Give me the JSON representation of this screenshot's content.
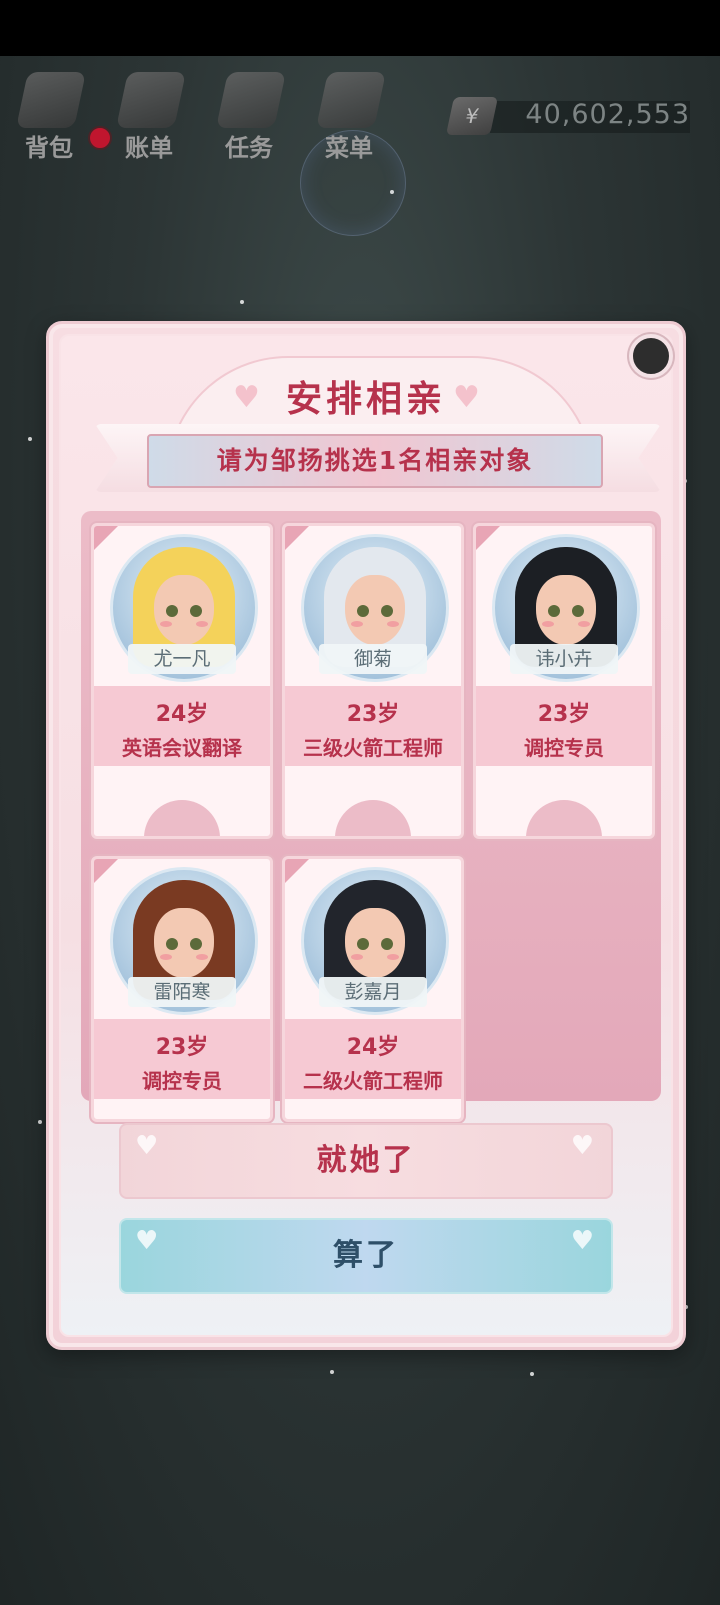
{
  "hud": {
    "items": [
      {
        "label": "背包",
        "icon": "bag-icon"
      },
      {
        "label": "账单",
        "icon": "bill-icon"
      },
      {
        "label": "任务",
        "icon": "task-icon"
      },
      {
        "label": "菜单",
        "icon": "menu-icon"
      }
    ],
    "currency_symbol": "¥",
    "money": "40,602,553"
  },
  "dialog": {
    "title": "安排相亲",
    "subtitle": "请为邹扬挑选1名相亲对象",
    "candidates": [
      {
        "name": "尤一凡",
        "age": "24岁",
        "job": "英语会议翻译",
        "hair_color": "#f4d25a"
      },
      {
        "name": "御菊",
        "age": "23岁",
        "job": "三级火箭工程师",
        "hair_color": "#e3e8ee"
      },
      {
        "name": "讳小卉",
        "age": "23岁",
        "job": "调控专员",
        "hair_color": "#1c1f24"
      },
      {
        "name": "雷陌寒",
        "age": "23岁",
        "job": "调控专员",
        "hair_color": "#7a3a22"
      },
      {
        "name": "彭嘉月",
        "age": "24岁",
        "job": "二级火箭工程师",
        "hair_color": "#22252c"
      }
    ],
    "confirm_label": "就她了",
    "cancel_label": "算了"
  }
}
